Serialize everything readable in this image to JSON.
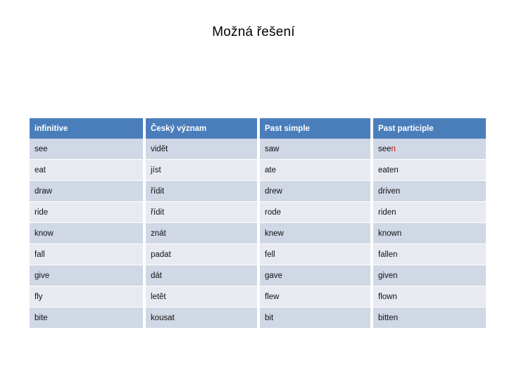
{
  "slide": {
    "title": "Možná řešení"
  },
  "table": {
    "headers": [
      "infinitive",
      "Český význam",
      "Past simple",
      "Past participle"
    ],
    "rows": [
      {
        "infinitive": "see",
        "czech": "vidět",
        "past_simple": "saw",
        "past_participle": "seen",
        "past_participle_stem": "see",
        "past_participle_highlight": "n"
      },
      {
        "infinitive": "eat",
        "czech": "jíst",
        "past_simple": "ate",
        "past_participle": "eaten"
      },
      {
        "infinitive": "draw",
        "czech": "řídit",
        "past_simple": "drew",
        "past_participle": "driven"
      },
      {
        "infinitive": "ride",
        "czech": "řídit",
        "past_simple": "rode",
        "past_participle": "riden"
      },
      {
        "infinitive": "know",
        "czech": "znát",
        "past_simple": "knew",
        "past_participle": "known"
      },
      {
        "infinitive": "fall",
        "czech": "padat",
        "past_simple": "fell",
        "past_participle": "fallen"
      },
      {
        "infinitive": "give",
        "czech": "dát",
        "past_simple": "gave",
        "past_participle": "given"
      },
      {
        "infinitive": "fly",
        "czech": "letět",
        "past_simple": "flew",
        "past_participle": "flown"
      },
      {
        "infinitive": "bite",
        "czech": "kousat",
        "past_simple": "bit",
        "past_participle": "bitten"
      }
    ]
  },
  "colors": {
    "header_background": "#4a7ebb",
    "header_text": "#ffffff",
    "row_odd_background": "#d0d7e5",
    "row_even_background": "#e8eaf2",
    "highlight_text": "#cc1111",
    "slide_background": "#ffffff"
  }
}
